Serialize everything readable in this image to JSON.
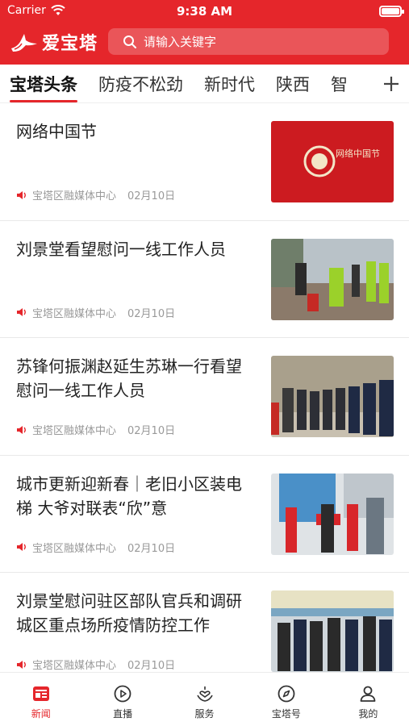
{
  "status_bar": {
    "carrier": "Carrier",
    "time": "9:38 AM"
  },
  "header": {
    "logo_text": "爱宝塔",
    "search_placeholder": "请输入关键字"
  },
  "tabs": [
    {
      "label": "宝塔头条",
      "active": true
    },
    {
      "label": "防疫不松劲",
      "active": false
    },
    {
      "label": "新时代",
      "active": false
    },
    {
      "label": "陕西",
      "active": false
    },
    {
      "label": "智",
      "active": false
    }
  ],
  "feed": [
    {
      "title": "网络中国节",
      "source": "宝塔区融媒体中心",
      "date": "02月10日",
      "thumb_text": "网络中国节"
    },
    {
      "title": "刘景堂看望慰问一线工作人员",
      "source": "宝塔区融媒体中心",
      "date": "02月10日"
    },
    {
      "title": "苏锋何振渊赵延生苏琳一行看望慰问一线工作人员",
      "source": "宝塔区融媒体中心",
      "date": "02月10日"
    },
    {
      "title": "城市更新迎新春｜老旧小区装电梯 大爷对联表“欣”意",
      "source": "宝塔区融媒体中心",
      "date": "02月10日"
    },
    {
      "title": "刘景堂慰问驻区部队官兵和调研城区重点场所疫情防控工作",
      "source": "宝塔区融媒体中心",
      "date": "02月10日"
    }
  ],
  "bottom_nav": [
    {
      "label": "新闻",
      "icon": "news-icon",
      "active": true
    },
    {
      "label": "直播",
      "icon": "play-icon",
      "active": false
    },
    {
      "label": "服务",
      "icon": "heart-hand-icon",
      "active": false
    },
    {
      "label": "宝塔号",
      "icon": "compass-icon",
      "active": false
    },
    {
      "label": "我的",
      "icon": "user-icon",
      "active": false
    }
  ],
  "colors": {
    "brand_red": "#e5262b",
    "meta_gray": "#999999"
  }
}
